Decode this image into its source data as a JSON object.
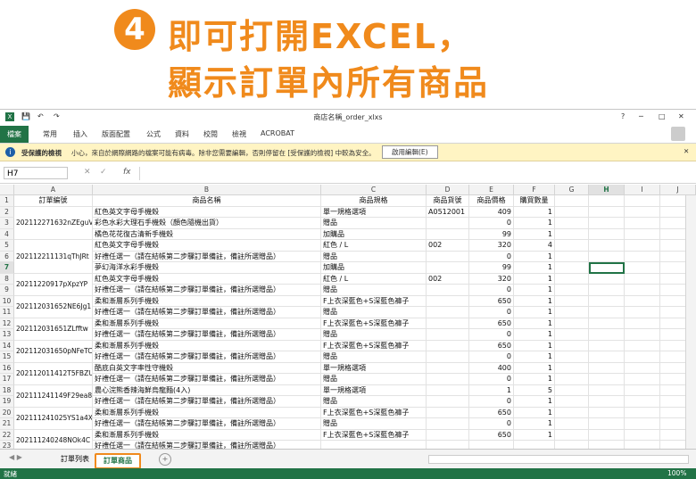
{
  "banner": {
    "step": "4",
    "line1": "即可打開EXCEL，",
    "line2": "顯示訂單內所有商品",
    "accent": "#f08a1c"
  },
  "window": {
    "title": "商店名稱_order_xlxs",
    "help": "?",
    "minimize": "─",
    "maximize": "□",
    "close": "✕"
  },
  "ribbon": {
    "tabs": [
      "檔案",
      "常用",
      "插入",
      "版面配置",
      "公式",
      "資料",
      "校閱",
      "檢視",
      "ACROBAT"
    ],
    "accent": "#217346"
  },
  "protected_view": {
    "title": "受保護的檢視",
    "message": "小心，來自於網際網路的檔案可能有病毒。除非您需要編輯，否則停留在 [受保護的檢視] 中較為安全。",
    "button": "啟用編輯(E)"
  },
  "formula_bar": {
    "cell_ref": "H7",
    "fx": "fx"
  },
  "columns": [
    "A",
    "B",
    "C",
    "D",
    "E",
    "F",
    "G",
    "H",
    "I",
    "J"
  ],
  "header_row": [
    "訂單編號",
    "商品名稱",
    "商品規格",
    "商品貨號",
    "商品價格",
    "購買數量"
  ],
  "rows": [
    {
      "n": "2",
      "b": "紅色英文字母手機殼",
      "c": "單一規格選項",
      "d": "A0512001",
      "e": "409",
      "f": "1"
    },
    {
      "n": "3",
      "b": "彩色水彩大理石手機殼（顏色隨機出貨）",
      "c": "贈品",
      "d": "",
      "e": "0",
      "f": "1"
    },
    {
      "n": "4",
      "b": "橘色花花復古清新手機殼",
      "c": "加購品",
      "d": "",
      "e": "99",
      "f": "1"
    },
    {
      "n": "5",
      "b": "紅色英文字母手機殼",
      "c": "紅色 / L",
      "d": "002",
      "e": "320",
      "f": "4"
    },
    {
      "n": "6",
      "b": "好禮任選一（請在結帳第二步驟訂單備註，備註所選贈品）",
      "c": "贈品",
      "d": "",
      "e": "0",
      "f": "1"
    },
    {
      "n": "7",
      "b": "夢幻海洋水彩手機殼",
      "c": "加購品",
      "d": "",
      "e": "99",
      "f": "1"
    },
    {
      "n": "8",
      "b": "紅色英文字母手機殼",
      "c": "紅色 / L",
      "d": "002",
      "e": "320",
      "f": "1"
    },
    {
      "n": "9",
      "b": "好禮任選一（請在結帳第二步驟訂單備註，備註所選贈品）",
      "c": "贈品",
      "d": "",
      "e": "0",
      "f": "1"
    },
    {
      "n": "10",
      "b": "柔和漸層系列手機殼",
      "c": "F上衣深藍色+S深藍色褲子",
      "d": "",
      "e": "650",
      "f": "1"
    },
    {
      "n": "11",
      "b": "好禮任選一（請在結帳第二步驟訂單備註，備註所選贈品）",
      "c": "贈品",
      "d": "",
      "e": "0",
      "f": "1"
    },
    {
      "n": "12",
      "b": "柔和漸層系列手機殼",
      "c": "F上衣深藍色+S深藍色褲子",
      "d": "",
      "e": "650",
      "f": "1"
    },
    {
      "n": "13",
      "b": "好禮任選一（請在結帳第二步驟訂單備註，備註所選贈品）",
      "c": "贈品",
      "d": "",
      "e": "0",
      "f": "1"
    },
    {
      "n": "14",
      "b": "柔和漸層系列手機殼",
      "c": "F上衣深藍色+S深藍色褲子",
      "d": "",
      "e": "650",
      "f": "1"
    },
    {
      "n": "15",
      "b": "好禮任選一（請在結帳第二步驟訂單備註，備註所選贈品）",
      "c": "贈品",
      "d": "",
      "e": "0",
      "f": "1"
    },
    {
      "n": "16",
      "b": "酷底白英文字率性守機殼",
      "c": "單一規格選項",
      "d": "",
      "e": "400",
      "f": "1"
    },
    {
      "n": "17",
      "b": "好禮任選一（請在結帳第二步驟訂單備註，備註所選贈品）",
      "c": "贈品",
      "d": "",
      "e": "0",
      "f": "1"
    },
    {
      "n": "18",
      "b": "農心浣熊香辣海鮮烏龍麵(4入)",
      "c": "單一規格選項",
      "d": "",
      "e": "1",
      "f": "5"
    },
    {
      "n": "19",
      "b": "好禮任選一（請在結帳第二步驟訂單備註，備註所選贈品）",
      "c": "贈品",
      "d": "",
      "e": "0",
      "f": "1"
    },
    {
      "n": "20",
      "b": "柔和漸層系列手機殼",
      "c": "F上衣深藍色+S深藍色褲子",
      "d": "",
      "e": "650",
      "f": "1"
    },
    {
      "n": "21",
      "b": "好禮任選一（請在結帳第二步驟訂單備註，備註所選贈品）",
      "c": "贈品",
      "d": "",
      "e": "0",
      "f": "1"
    },
    {
      "n": "22",
      "b": "柔和漸層系列手機殼",
      "c": "F上衣深藍色+S深藍色褲子",
      "d": "",
      "e": "650",
      "f": "1"
    },
    {
      "n": "23",
      "b": "好禮任選一（請在結帳第二步驟訂單備註，備註所選贈品）",
      "c": "",
      "d": "",
      "e": "",
      "f": ""
    }
  ],
  "order_groups": [
    {
      "id": "202112271632nZEguV",
      "first": 0,
      "span": 3
    },
    {
      "id": "202112211131qThJRt",
      "first": 3,
      "span": 3
    },
    {
      "id": "20211220917pXpzYP",
      "first": 6,
      "span": 2
    },
    {
      "id": "202112031652NE6Jg1",
      "first": 8,
      "span": 2
    },
    {
      "id": "202112031651ZLfftw",
      "first": 10,
      "span": 2
    },
    {
      "id": "202112031650pNFeTC",
      "first": 12,
      "span": 2
    },
    {
      "id": "202112011412T5FBZU",
      "first": 14,
      "span": 2
    },
    {
      "id": "202111241149F29ea8",
      "first": 16,
      "span": 2
    },
    {
      "id": "202111241025YS1a4X",
      "first": 18,
      "span": 2
    },
    {
      "id": "202111240248NOk4C",
      "first": 20,
      "span": 2
    }
  ],
  "sheets": [
    "訂單列表",
    "訂單商品"
  ],
  "active_sheet": "訂單商品",
  "status": {
    "ready": "就緒",
    "zoom": "100%"
  }
}
